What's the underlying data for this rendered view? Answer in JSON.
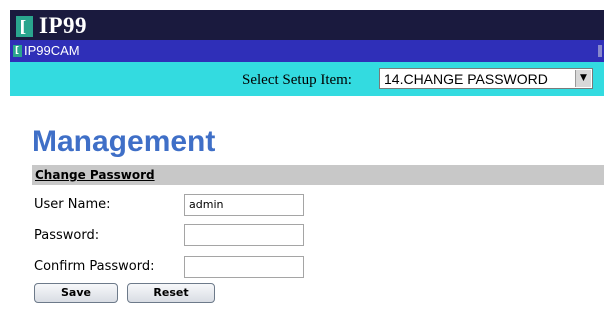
{
  "header": {
    "logo_glyph": "[",
    "brand": "IP99"
  },
  "subheader": {
    "logo_glyph": "[",
    "title": "IP99CAM"
  },
  "setup": {
    "label": "Select Setup Item:",
    "selected": "14.CHANGE PASSWORD",
    "arrow": "▼"
  },
  "page": {
    "title": "Management",
    "section_title": "Change Password"
  },
  "form": {
    "username_label": "User Name:",
    "username_value": "admin",
    "password_label": "Password:",
    "password_value": "",
    "confirm_label": "Confirm Password:",
    "confirm_value": "",
    "save_label": "Save",
    "reset_label": "Reset"
  },
  "colors": {
    "topbar": "#1a1a3e",
    "subbar": "#2f2fb8",
    "setupbar": "#33dbe0",
    "title_blue": "#3f6fc7",
    "section_gray": "#c8c8c8",
    "logo_teal": "#2aa58e"
  }
}
